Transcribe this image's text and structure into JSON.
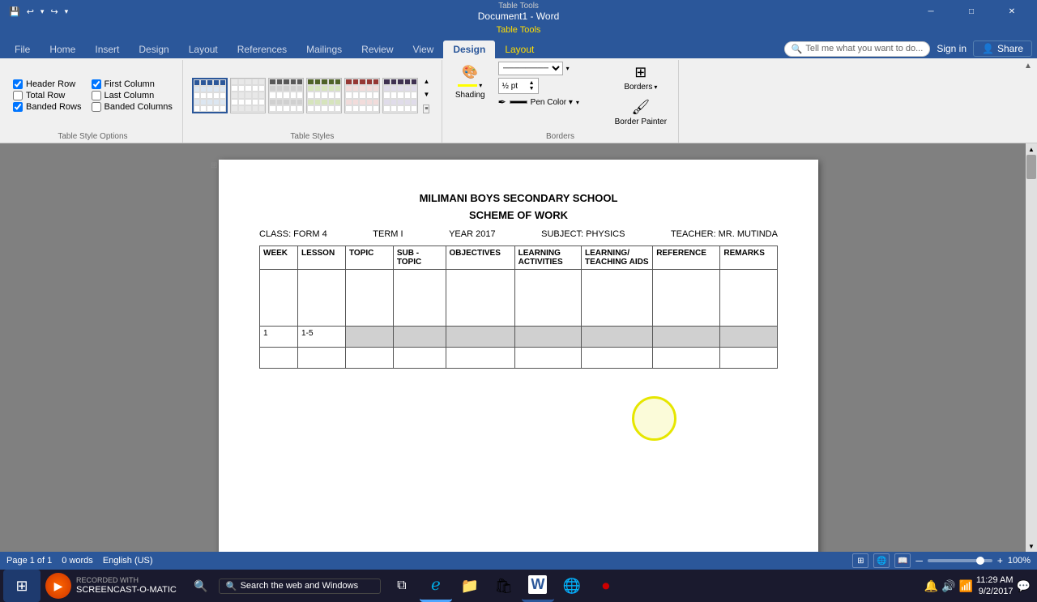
{
  "titlebar": {
    "title": "Document1 - Word",
    "context_tab": "Table Tools",
    "minimize": "─",
    "maximize": "□",
    "close": "✕"
  },
  "qat": {
    "save": "💾",
    "undo": "↩",
    "redo": "↪"
  },
  "ribbon_tabs": [
    {
      "id": "file",
      "label": "File"
    },
    {
      "id": "home",
      "label": "Home"
    },
    {
      "id": "insert",
      "label": "Insert"
    },
    {
      "id": "design",
      "label": "Design"
    },
    {
      "id": "layout_page",
      "label": "Layout"
    },
    {
      "id": "references",
      "label": "References"
    },
    {
      "id": "mailings",
      "label": "Mailings"
    },
    {
      "id": "review",
      "label": "Review"
    },
    {
      "id": "view",
      "label": "View"
    },
    {
      "id": "design_tt",
      "label": "Design",
      "context": true
    },
    {
      "id": "layout_tt",
      "label": "Layout",
      "context": true
    }
  ],
  "table_style_options": {
    "header_row": {
      "label": "Header Row",
      "checked": true
    },
    "first_column": {
      "label": "First Column",
      "checked": true
    },
    "total_row": {
      "label": "Total Row",
      "checked": false
    },
    "last_column": {
      "label": "Last Column",
      "checked": false
    },
    "banded_rows": {
      "label": "Banded Rows",
      "checked": true
    },
    "banded_columns": {
      "label": "Banded Columns",
      "checked": false
    },
    "group_label": "Table Style Options"
  },
  "table_styles": {
    "group_label": "Table Styles"
  },
  "borders": {
    "shading_label": "Shading",
    "border_styles_label": "Border Styles ▾",
    "borders_label": "Borders",
    "border_painter_label": "Border Painter",
    "pt_value": "½ pt",
    "pen_color_label": "Pen Color ▾",
    "group_label": "Borders"
  },
  "tell_me": {
    "placeholder": "Tell me what you want to do..."
  },
  "user": {
    "sign_in": "Sign in",
    "share": "Share"
  },
  "document": {
    "title": "MILIMANI BOYS SECONDARY SCHOOL",
    "subtitle": "SCHEME OF WORK",
    "class_label": "CLASS: FORM 4",
    "term_label": "TERM I",
    "year_label": "YEAR 2017",
    "subject_label": "SUBJECT: PHYSICS",
    "teacher_label": "TEACHER: MR. MUTINDA",
    "table": {
      "headers": [
        "WEEK",
        "LESSON",
        "TOPIC",
        "SUB - TOPIC",
        "OBJECTIVES",
        "LEARNING ACTIVITIES",
        "LEARNING / TEACHING AIDS",
        "REFERENCE",
        "REMARKS"
      ],
      "rows": [
        [
          "",
          "",
          "",
          "",
          "",
          "",
          "",
          "",
          ""
        ],
        [
          "1",
          "1-5",
          "",
          "",
          "",
          "",
          "",
          "",
          ""
        ],
        [
          "",
          "",
          "",
          "",
          "",
          "",
          "",
          "",
          ""
        ]
      ]
    }
  },
  "status_bar": {
    "page": "Page 1 of 1",
    "words": "0 words",
    "language": "English (US)",
    "zoom": "100%"
  },
  "taskbar": {
    "time": "11:29 AM",
    "date": "9/2/2017",
    "screencast_label": "RECORDED WITH"
  },
  "watermark": "SCREENCAST-O-MATIC"
}
